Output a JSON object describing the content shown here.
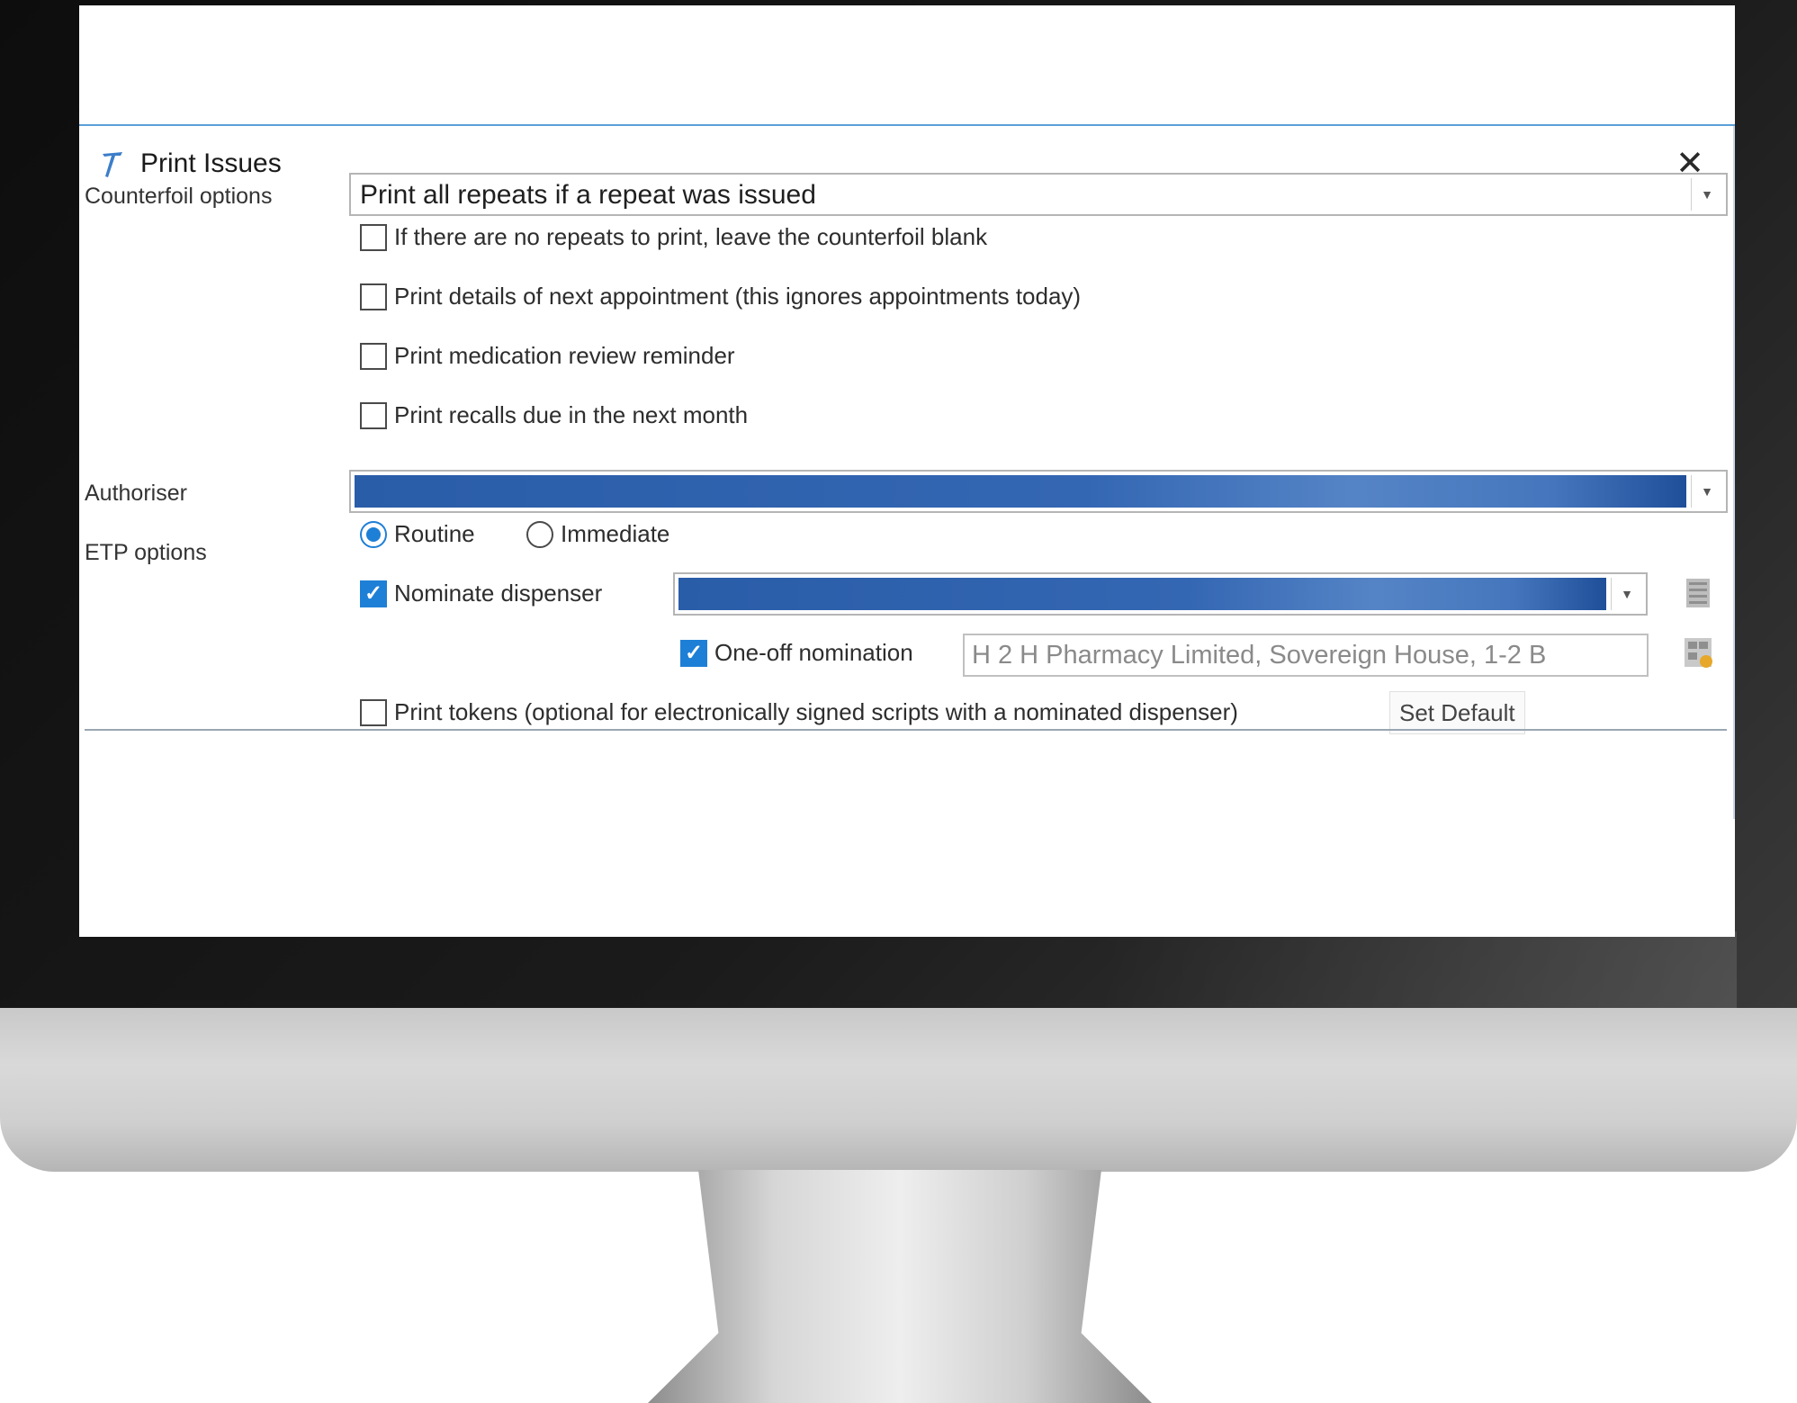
{
  "dialog": {
    "title": "Print Issues",
    "close_symbol": "✕"
  },
  "counterfoil": {
    "label": "Counterfoil options",
    "selected": "Print all repeats if a repeat was issued",
    "options": [
      {
        "label": "If there are no repeats to print, leave the counterfoil blank",
        "checked": false
      },
      {
        "label": "Print details of next appointment (this ignores appointments today)",
        "checked": false
      },
      {
        "label": "Print medication review reminder",
        "checked": false
      },
      {
        "label": "Print recalls due in the next month",
        "checked": false
      }
    ]
  },
  "authoriser": {
    "label": "Authoriser"
  },
  "etp": {
    "label": "ETP options",
    "radios": [
      {
        "label": "Routine",
        "selected": true
      },
      {
        "label": "Immediate",
        "selected": false
      }
    ],
    "nominate": {
      "label": "Nominate dispenser",
      "checked": true
    },
    "one_off": {
      "label": "One-off nomination",
      "checked": true,
      "value": "H 2 H Pharmacy Limited, Sovereign House, 1-2 B"
    },
    "print_tokens": {
      "label": "Print tokens (optional for electronically signed scripts with a nominated dispenser)",
      "checked": false
    },
    "set_default_label": "Set Default"
  },
  "icons": {
    "app": "app-logo-icon",
    "close": "close-icon",
    "dropdown": "chevron-down-icon",
    "pharmacy_search": "pharmacy-lookup-icon",
    "pharmacy_map": "pharmacy-map-icon"
  },
  "colors": {
    "accent": "#1e7fd6",
    "selection": "#3467b3",
    "title_rule": "#5aa0d8"
  }
}
